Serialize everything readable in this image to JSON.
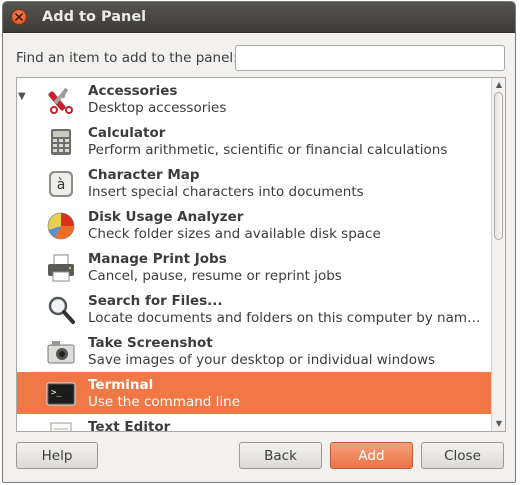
{
  "window": {
    "title": "Add to Panel"
  },
  "search": {
    "label": "Find an item to add to the panel:",
    "value": "",
    "placeholder": ""
  },
  "items": [
    {
      "name": "Accessories",
      "desc": "Desktop accessories",
      "icon": "scissors-icon"
    },
    {
      "name": "Calculator",
      "desc": "Perform arithmetic, scientific or financial calculations",
      "icon": "calculator-icon"
    },
    {
      "name": "Character Map",
      "desc": "Insert special characters into documents",
      "icon": "character-map-icon"
    },
    {
      "name": "Disk Usage Analyzer",
      "desc": "Check folder sizes and available disk space",
      "icon": "pie-chart-icon"
    },
    {
      "name": "Manage Print Jobs",
      "desc": "Cancel, pause, resume or reprint jobs",
      "icon": "printer-icon"
    },
    {
      "name": "Search for Files...",
      "desc": "Locate documents and folders on this computer by name o...",
      "icon": "magnifier-icon"
    },
    {
      "name": "Take Screenshot",
      "desc": "Save images of your desktop or individual windows",
      "icon": "camera-icon"
    },
    {
      "name": "Terminal",
      "desc": "Use the command line",
      "icon": "terminal-icon",
      "selected": true
    },
    {
      "name": "Text Editor",
      "desc": "",
      "icon": "text-editor-icon"
    }
  ],
  "buttons": {
    "help": "Help",
    "back": "Back",
    "add": "Add",
    "close": "Close"
  },
  "colors": {
    "selection": "#f07746",
    "titlebar": "#3d3c38",
    "accent": "#eb7447"
  }
}
